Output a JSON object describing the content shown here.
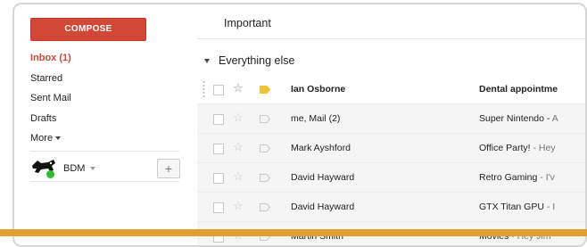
{
  "sidebar": {
    "compose_label": "COMPOSE",
    "items": [
      {
        "label": "Inbox (1)",
        "active": true
      },
      {
        "label": "Starred"
      },
      {
        "label": "Sent Mail"
      },
      {
        "label": "Drafts"
      },
      {
        "label": "More"
      }
    ],
    "account_name": "BDM",
    "add_label": "+"
  },
  "main": {
    "title": "Important",
    "section_title": "Everything else",
    "messages": [
      {
        "sender": "Ian Osborne",
        "subject": "Dental appointme",
        "snippet": "",
        "unread": true,
        "important": true
      },
      {
        "sender": "me, Mail (2)",
        "subject": "Super Nintendo - ",
        "snippet": "A",
        "unread": false,
        "important": false
      },
      {
        "sender": "Mark Ayshford",
        "subject": "Office Party!",
        "snippet": " - Hey",
        "unread": false,
        "important": false
      },
      {
        "sender": "David Hayward",
        "subject": "Retro Gaming",
        "snippet": " - I'v",
        "unread": false,
        "important": false
      },
      {
        "sender": "David Hayward",
        "subject": "GTX Titan GPU",
        "snippet": " - I",
        "unread": false,
        "important": false
      },
      {
        "sender": "Martin Smith",
        "subject": "Movies",
        "snippet": " - Hey Jim",
        "unread": false,
        "important": false
      }
    ]
  },
  "colors": {
    "compose": "#d14836",
    "important_tag": "#f0c330",
    "accent_bar": "#e0a030",
    "online": "#2fbd2f"
  },
  "icons": {
    "star": "star-icon",
    "tag": "important-marker-icon",
    "avatar": "dog-avatar-icon"
  }
}
